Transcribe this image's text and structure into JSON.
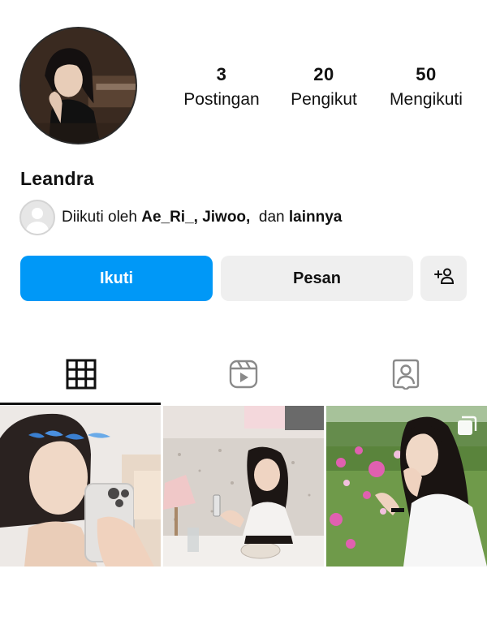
{
  "profile": {
    "username": "Leandra",
    "stats": {
      "posts": {
        "value": "3",
        "label": "Postingan"
      },
      "followers": {
        "value": "20",
        "label": "Pengikut"
      },
      "following": {
        "value": "50",
        "label": "Mengikuti"
      }
    },
    "followed_by": {
      "prefix": "Diikuti oleh ",
      "names": "Ae_Ri_, Jiwoo,",
      "connector": "  dan ",
      "others": "lainnya"
    }
  },
  "actions": {
    "follow_label": "Ikuti",
    "message_label": "Pesan",
    "add_user_icon": "person-add-icon",
    "follow_color": "#0098f7"
  },
  "tabs": [
    {
      "name": "posts",
      "icon": "grid-icon",
      "active": true
    },
    {
      "name": "reels",
      "icon": "reels-icon",
      "active": false
    },
    {
      "name": "tagged",
      "icon": "tagged-person-icon",
      "active": false
    }
  ],
  "posts": [
    {
      "name": "post-mirror-selfie",
      "multi": false
    },
    {
      "name": "post-cafe-table",
      "multi": false
    },
    {
      "name": "post-flower-field",
      "multi": true
    }
  ]
}
